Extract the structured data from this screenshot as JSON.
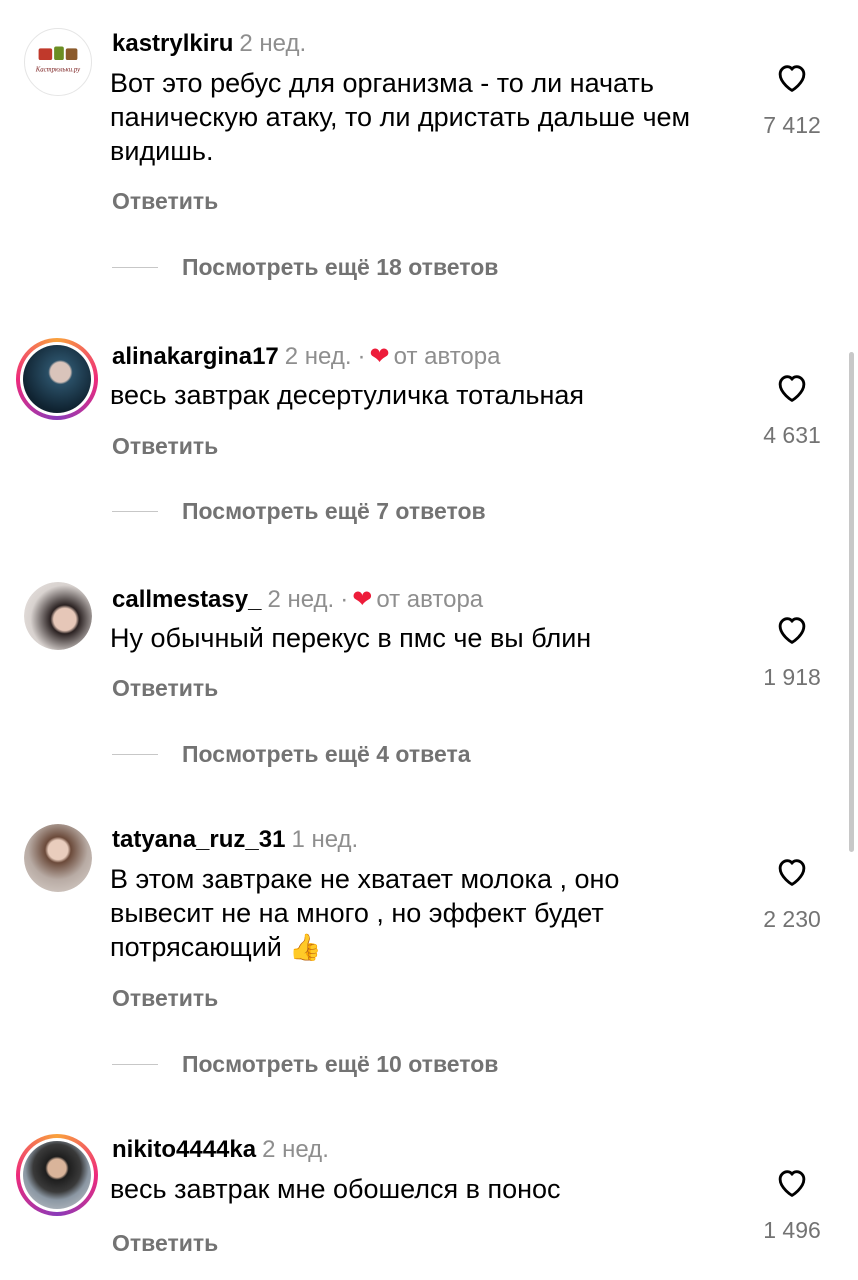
{
  "comments": [
    {
      "username": "kastrylkiru",
      "time": "2 нед.",
      "text": "Вот это ребус для организма - то ли начать паническую атаку, то ли дристать дальше чем видишь.",
      "reply": "Ответить",
      "likes": "7 412",
      "more_replies": "Посмотреть ещё 18 ответов",
      "avatar_label": "Кастрюльки.ру"
    },
    {
      "username": "alinakargina17",
      "time": "2 нед.",
      "author_tag": "от автора",
      "text": "весь завтрак десертуличка тотальная",
      "reply": "Ответить",
      "likes": "4 631",
      "more_replies": "Посмотреть ещё 7 ответов"
    },
    {
      "username": "callmestasy_",
      "time": "2 нед.",
      "author_tag": "от автора",
      "text": "Ну обычный перекус в пмс че вы блин",
      "reply": "Ответить",
      "likes": "1 918",
      "more_replies": "Посмотреть ещё 4 ответа"
    },
    {
      "username": "tatyana_ruz_31",
      "time": "1 нед.",
      "text": "В этом завтраке не хватает  молока , оно вывесит не на много , но эффект будет потрясающий",
      "emoji": "👍",
      "reply": "Ответить",
      "likes": "2 230",
      "more_replies": "Посмотреть ещё 10 ответов"
    },
    {
      "username": "nikito4444ka",
      "time": "2 нед.",
      "text": "весь завтрак мне обошелся в понос",
      "reply": "Ответить",
      "likes": "1 496"
    }
  ],
  "meta_separator": "·",
  "colors": {
    "secondary_text": "#737373",
    "author_heart": "#ed1c3a"
  },
  "icons": {
    "like": "heart-outline-icon",
    "author_like": "heart-filled-icon"
  }
}
